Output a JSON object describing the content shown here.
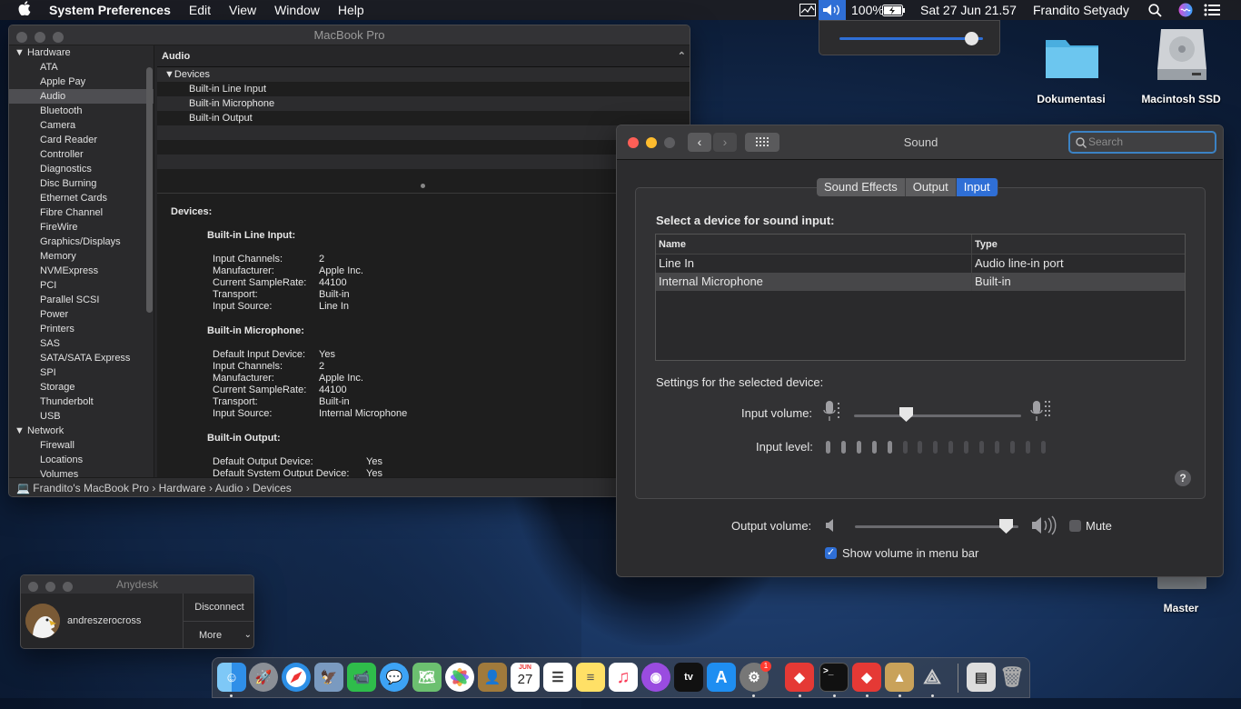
{
  "menubar": {
    "apple": "",
    "app_name": "System Preferences",
    "items": [
      "Edit",
      "View",
      "Window",
      "Help"
    ],
    "battery": "100%",
    "datetime": "Sat 27 Jun  21.57",
    "user": "Frandito Setyady"
  },
  "volume_popup": {
    "level": 0.92
  },
  "desktop": {
    "icons": [
      {
        "label": "Dokumentasi"
      },
      {
        "label": "Macintosh SSD"
      },
      {
        "label": "Master"
      }
    ]
  },
  "sysinfo": {
    "title": "MacBook Pro",
    "sidebar": [
      {
        "label": "Hardware",
        "section": true
      },
      {
        "label": "ATA"
      },
      {
        "label": "Apple Pay"
      },
      {
        "label": "Audio",
        "selected": true
      },
      {
        "label": "Bluetooth"
      },
      {
        "label": "Camera"
      },
      {
        "label": "Card Reader"
      },
      {
        "label": "Controller"
      },
      {
        "label": "Diagnostics"
      },
      {
        "label": "Disc Burning"
      },
      {
        "label": "Ethernet Cards"
      },
      {
        "label": "Fibre Channel"
      },
      {
        "label": "FireWire"
      },
      {
        "label": "Graphics/Displays"
      },
      {
        "label": "Memory"
      },
      {
        "label": "NVMExpress"
      },
      {
        "label": "PCI"
      },
      {
        "label": "Parallel SCSI"
      },
      {
        "label": "Power"
      },
      {
        "label": "Printers"
      },
      {
        "label": "SAS"
      },
      {
        "label": "SATA/SATA Express"
      },
      {
        "label": "SPI"
      },
      {
        "label": "Storage"
      },
      {
        "label": "Thunderbolt"
      },
      {
        "label": "USB"
      },
      {
        "label": "Network",
        "section": true
      },
      {
        "label": "Firewall"
      },
      {
        "label": "Locations"
      },
      {
        "label": "Volumes"
      }
    ],
    "header": "Audio",
    "tree_root": "Devices",
    "tree_items": [
      "Built-in Line Input",
      "Built-in Microphone",
      "Built-in Output"
    ],
    "detail_heading": "Devices:",
    "sections": [
      {
        "title": "Built-in Line Input:",
        "rows": [
          {
            "k": "Input Channels:",
            "v": "2"
          },
          {
            "k": "Manufacturer:",
            "v": "Apple Inc."
          },
          {
            "k": "Current SampleRate:",
            "v": "44100"
          },
          {
            "k": "Transport:",
            "v": "Built-in"
          },
          {
            "k": "Input Source:",
            "v": "Line In"
          }
        ]
      },
      {
        "title": "Built-in Microphone:",
        "rows": [
          {
            "k": "Default Input Device:",
            "v": "Yes"
          },
          {
            "k": "Input Channels:",
            "v": "2"
          },
          {
            "k": "Manufacturer:",
            "v": "Apple Inc."
          },
          {
            "k": "Current SampleRate:",
            "v": "44100"
          },
          {
            "k": "Transport:",
            "v": "Built-in"
          },
          {
            "k": "Input Source:",
            "v": "Internal Microphone"
          }
        ]
      },
      {
        "title": "Built-in Output:",
        "rows": [
          {
            "k": "Default Output Device:",
            "v": "Yes"
          },
          {
            "k": "Default System Output Device:",
            "v": "Yes"
          }
        ]
      }
    ],
    "breadcrumb": [
      "Frandito's MacBook Pro",
      "Hardware",
      "Audio",
      "Devices"
    ]
  },
  "sound": {
    "title": "Sound",
    "search_placeholder": "Search",
    "tabs": [
      {
        "label": "Sound Effects"
      },
      {
        "label": "Output"
      },
      {
        "label": "Input",
        "active": true
      }
    ],
    "select_label": "Select a device for sound input:",
    "columns": [
      "Name",
      "Type"
    ],
    "devices": [
      {
        "name": "Line In",
        "type": "Audio line-in port"
      },
      {
        "name": "Internal Microphone",
        "type": "Built-in",
        "selected": true
      }
    ],
    "settings_label": "Settings for the selected device:",
    "input_volume_label": "Input volume:",
    "input_volume": 0.31,
    "input_level_label": "Input level:",
    "input_level_active": 5,
    "input_level_total": 15,
    "output_volume_label": "Output volume:",
    "output_volume": 0.92,
    "mute_label": "Mute",
    "mute_checked": false,
    "show_volume_label": "Show volume in menu bar",
    "show_volume_checked": true
  },
  "anydesk": {
    "title": "Anydesk",
    "user": "andreszerocross",
    "disconnect": "Disconnect",
    "more": "More"
  },
  "dock": {
    "calendar_month": "JUN",
    "calendar_day": "27",
    "prefs_badge": "1"
  }
}
